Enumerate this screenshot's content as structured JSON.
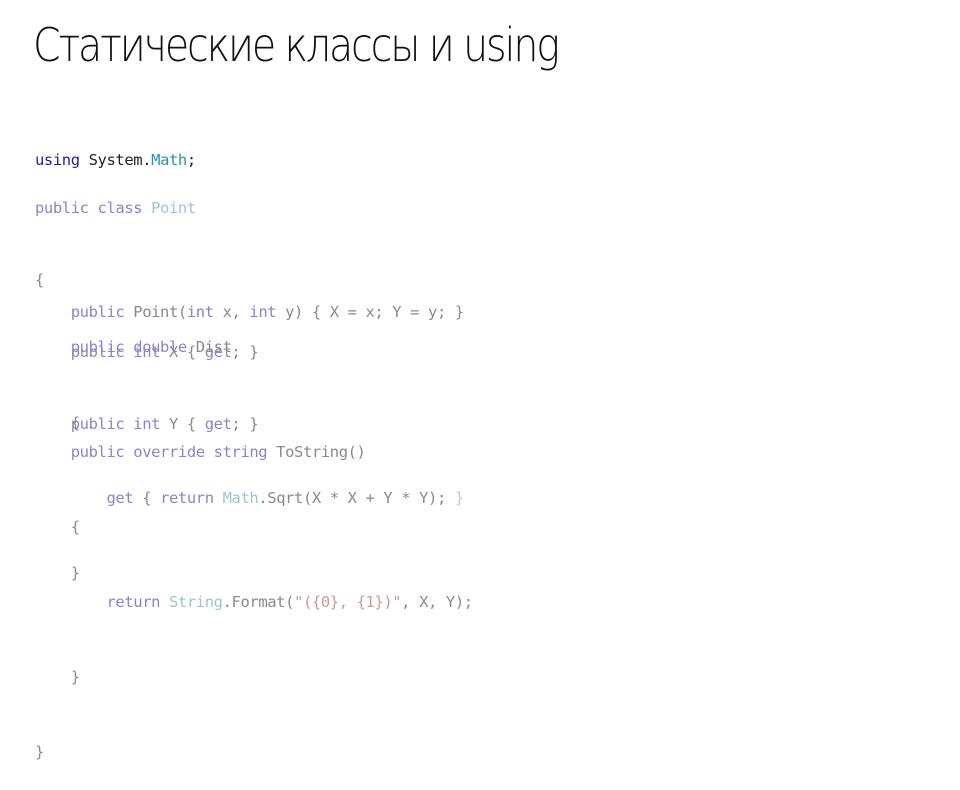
{
  "slide": {
    "title": "Статические классы и using"
  },
  "code": {
    "using_line": {
      "kw": "using",
      "ns": " System.",
      "type": "Math",
      "end": ";"
    },
    "class_decl": {
      "kw": "public class",
      "name": " Point"
    },
    "open_brace": "{",
    "prop_x": {
      "indent": "    ",
      "kw1": "public",
      "kw2": " int",
      "rest": " X { ",
      "get": "get",
      "end": "; }"
    },
    "prop_y": {
      "indent": "    ",
      "kw1": "public",
      "kw2": " int",
      "rest": " Y { ",
      "get": "get",
      "end": "; }"
    },
    "ctor": {
      "indent": "    ",
      "kw": "public",
      "name": " Point(",
      "int1": "int",
      "p1": " x, ",
      "int2": "int",
      "p2": " y) { X = x; Y = y; }"
    },
    "dist_decl": {
      "indent": "    ",
      "kw": "public double",
      "name": " Dist"
    },
    "dist_open": "    {",
    "dist_get": {
      "indent": "        ",
      "get": "get",
      "b1": " { ",
      "ret": "return",
      "sp": " ",
      "type": "Math",
      "rest": ".Sqrt(X * X + Y * Y); ",
      "close": "}"
    },
    "dist_close": "    }",
    "tostring_decl": {
      "indent": "    ",
      "kw": "public override string",
      "name": " ToString()"
    },
    "tostring_open": "    {",
    "tostring_ret": {
      "indent": "        ",
      "ret": "return",
      "sp": " ",
      "type": "String",
      "rest": ".Format(",
      "str": "\"({0}, {1})\"",
      "end": ", X, Y);"
    },
    "tostring_close": "    }",
    "close_brace": "}"
  }
}
